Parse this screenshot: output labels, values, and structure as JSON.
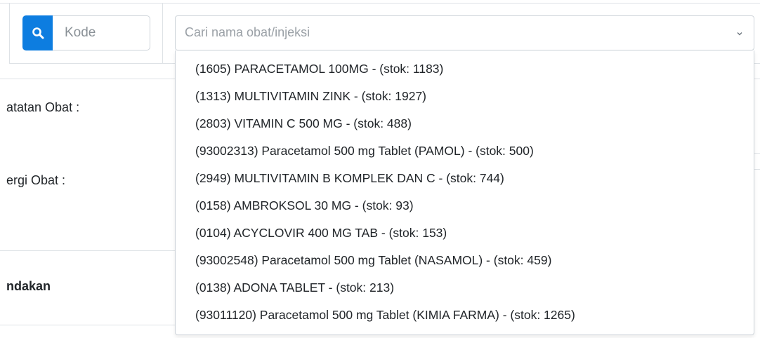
{
  "search": {
    "button_icon": "search-icon",
    "kode_placeholder": "Kode",
    "select_placeholder": "Cari nama obat/injeksi",
    "chevron_icon": "chevron-down-icon"
  },
  "labels": {
    "catatan_obat": "atatan Obat :",
    "alergi_obat": "ergi Obat :",
    "tindakan": "ndakan"
  },
  "dropdown": {
    "options": [
      "(1605) PARACETAMOL 100MG - (stok: 1183)",
      "(1313) MULTIVITAMIN ZINK - (stok: 1927)",
      "(2803) VITAMIN C 500 MG - (stok: 488)",
      "(93002313) Paracetamol 500 mg Tablet (PAMOL) - (stok: 500)",
      "(2949) MULTIVITAMIN B KOMPLEK DAN C - (stok: 744)",
      "(0158) AMBROKSOL 30 MG - (stok: 93)",
      "(0104) ACYCLOVIR 400 MG TAB - (stok: 153)",
      "(93002548) Paracetamol 500 mg Tablet (NASAMOL) - (stok: 459)",
      "(0138) ADONA TABLET - (stok: 213)",
      "(93011120) Paracetamol 500 mg Tablet (KIMIA FARMA) - (stok: 1265)"
    ]
  },
  "colors": {
    "primary": "#0d7de0",
    "border": "#ced4da",
    "divider": "#dee2e6"
  }
}
